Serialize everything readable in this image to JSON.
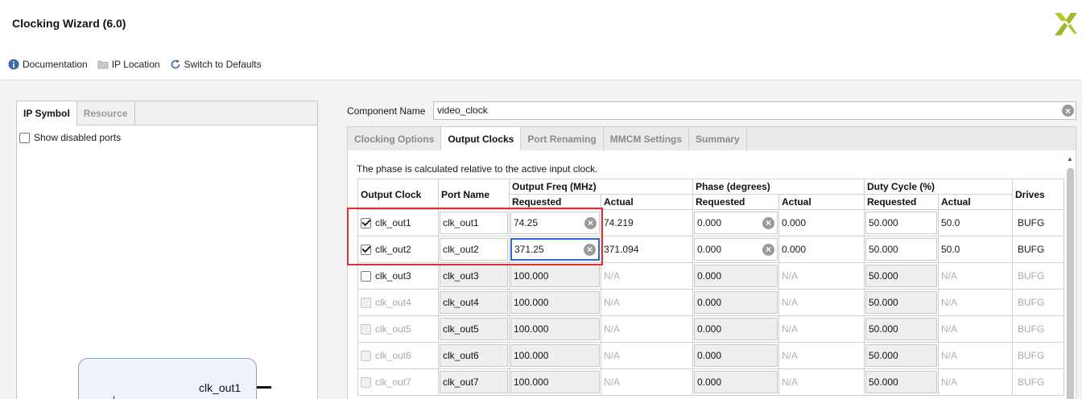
{
  "app": {
    "title": "Clocking Wizard (6.0)"
  },
  "toolbar": {
    "documentation": "Documentation",
    "ip_location": "IP Location",
    "switch_defaults": "Switch to Defaults"
  },
  "left_tabs": [
    "IP Symbol",
    "Resource"
  ],
  "show_disabled_ports": "Show disabled ports",
  "ip_symbol": {
    "port": "clk_out1"
  },
  "component": {
    "label": "Component Name",
    "value": "video_clock"
  },
  "tabs": [
    "Clocking Options",
    "Output Clocks",
    "Port Renaming",
    "MMCM Settings",
    "Summary"
  ],
  "note": "The phase is calculated relative to the active input clock.",
  "headers": {
    "output_clock": "Output Clock",
    "port_name": "Port Name",
    "output_freq": "Output Freq (MHz)",
    "phase": "Phase (degrees)",
    "duty": "Duty Cycle (%)",
    "requested": "Requested",
    "actual": "Actual",
    "drives": "Drives"
  },
  "rows": [
    {
      "name": "clk_out1",
      "port": "clk_out1",
      "freq_req": "74.25",
      "freq_act": "74.219",
      "phase_req": "0.000",
      "phase_act": "0.000",
      "duty_req": "50.000",
      "duty_act": "50.0",
      "drives": "BUFG"
    },
    {
      "name": "clk_out2",
      "port": "clk_out2",
      "freq_req": "371.25",
      "freq_act": "371.094",
      "phase_req": "0.000",
      "phase_act": "0.000",
      "duty_req": "50.000",
      "duty_act": "50.0",
      "drives": "BUFG"
    },
    {
      "name": "clk_out3",
      "port": "clk_out3",
      "freq_req": "100.000",
      "freq_act": "N/A",
      "phase_req": "0.000",
      "phase_act": "N/A",
      "duty_req": "50.000",
      "duty_act": "N/A",
      "drives": "BUFG"
    },
    {
      "name": "clk_out4",
      "port": "clk_out4",
      "freq_req": "100.000",
      "freq_act": "N/A",
      "phase_req": "0.000",
      "phase_act": "N/A",
      "duty_req": "50.000",
      "duty_act": "N/A",
      "drives": "BUFG"
    },
    {
      "name": "clk_out5",
      "port": "clk_out5",
      "freq_req": "100.000",
      "freq_act": "N/A",
      "phase_req": "0.000",
      "phase_act": "N/A",
      "duty_req": "50.000",
      "duty_act": "N/A",
      "drives": "BUFG"
    },
    {
      "name": "clk_out6",
      "port": "clk_out6",
      "freq_req": "100.000",
      "freq_act": "N/A",
      "phase_req": "0.000",
      "phase_act": "N/A",
      "duty_req": "50.000",
      "duty_act": "N/A",
      "drives": "BUFG"
    },
    {
      "name": "clk_out7",
      "port": "clk_out7",
      "freq_req": "100.000",
      "freq_act": "N/A",
      "phase_req": "0.000",
      "phase_act": "N/A",
      "duty_req": "50.000",
      "duty_act": "N/A",
      "drives": "BUFG"
    }
  ],
  "colors": {
    "highlight": "#e03030",
    "focus": "#2e6bc8",
    "logo": "#b8c832"
  },
  "icons": {
    "documentation": "info-icon",
    "ip_location": "folder-icon",
    "switch_defaults": "refresh-icon",
    "clear": "clear-icon"
  }
}
